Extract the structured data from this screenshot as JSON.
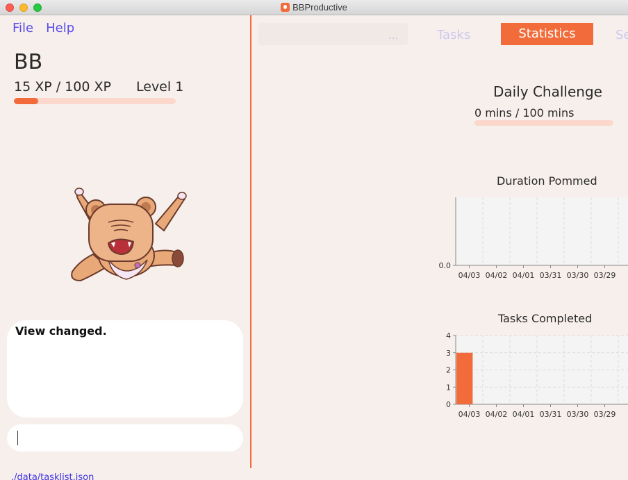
{
  "window": {
    "title": "BBProductive"
  },
  "menu": {
    "file": "File",
    "help": "Help"
  },
  "user": {
    "name": "BB",
    "xp_text": "15 XP / 100 XP",
    "level_text": "Level 1",
    "xp_fraction": 0.15
  },
  "result": {
    "text": "View changed."
  },
  "command": {
    "value": ""
  },
  "status": {
    "path": "./data/tasklist.json"
  },
  "tabs": {
    "hidden_tab_label": "...",
    "tasks": "Tasks",
    "statistics": "Statistics",
    "settings": "Se"
  },
  "daily_challenge": {
    "title": "Daily Challenge",
    "text": "0 mins / 100 mins",
    "progress_fraction": 0
  },
  "colors": {
    "accent": "#f26b3a",
    "bar_track": "#fbd7cc",
    "link": "#5b4ee6"
  },
  "chart_data": [
    {
      "type": "bar",
      "title": "Duration Pommed",
      "categories": [
        "04/03",
        "04/02",
        "04/01",
        "03/31",
        "03/30",
        "03/29"
      ],
      "values": [
        0,
        0,
        0,
        0,
        0,
        0
      ],
      "y_ticks": [
        "0.0"
      ],
      "ylim": [
        0,
        1
      ],
      "grid": true
    },
    {
      "type": "bar",
      "title": "Tasks Completed",
      "categories": [
        "04/03",
        "04/02",
        "04/01",
        "03/31",
        "03/30",
        "03/29"
      ],
      "values": [
        3,
        0,
        0,
        0,
        0,
        0
      ],
      "y_ticks": [
        "0",
        "1",
        "2",
        "3",
        "4"
      ],
      "ylim": [
        0,
        4
      ],
      "grid": true,
      "color": "#f26b3a"
    }
  ]
}
